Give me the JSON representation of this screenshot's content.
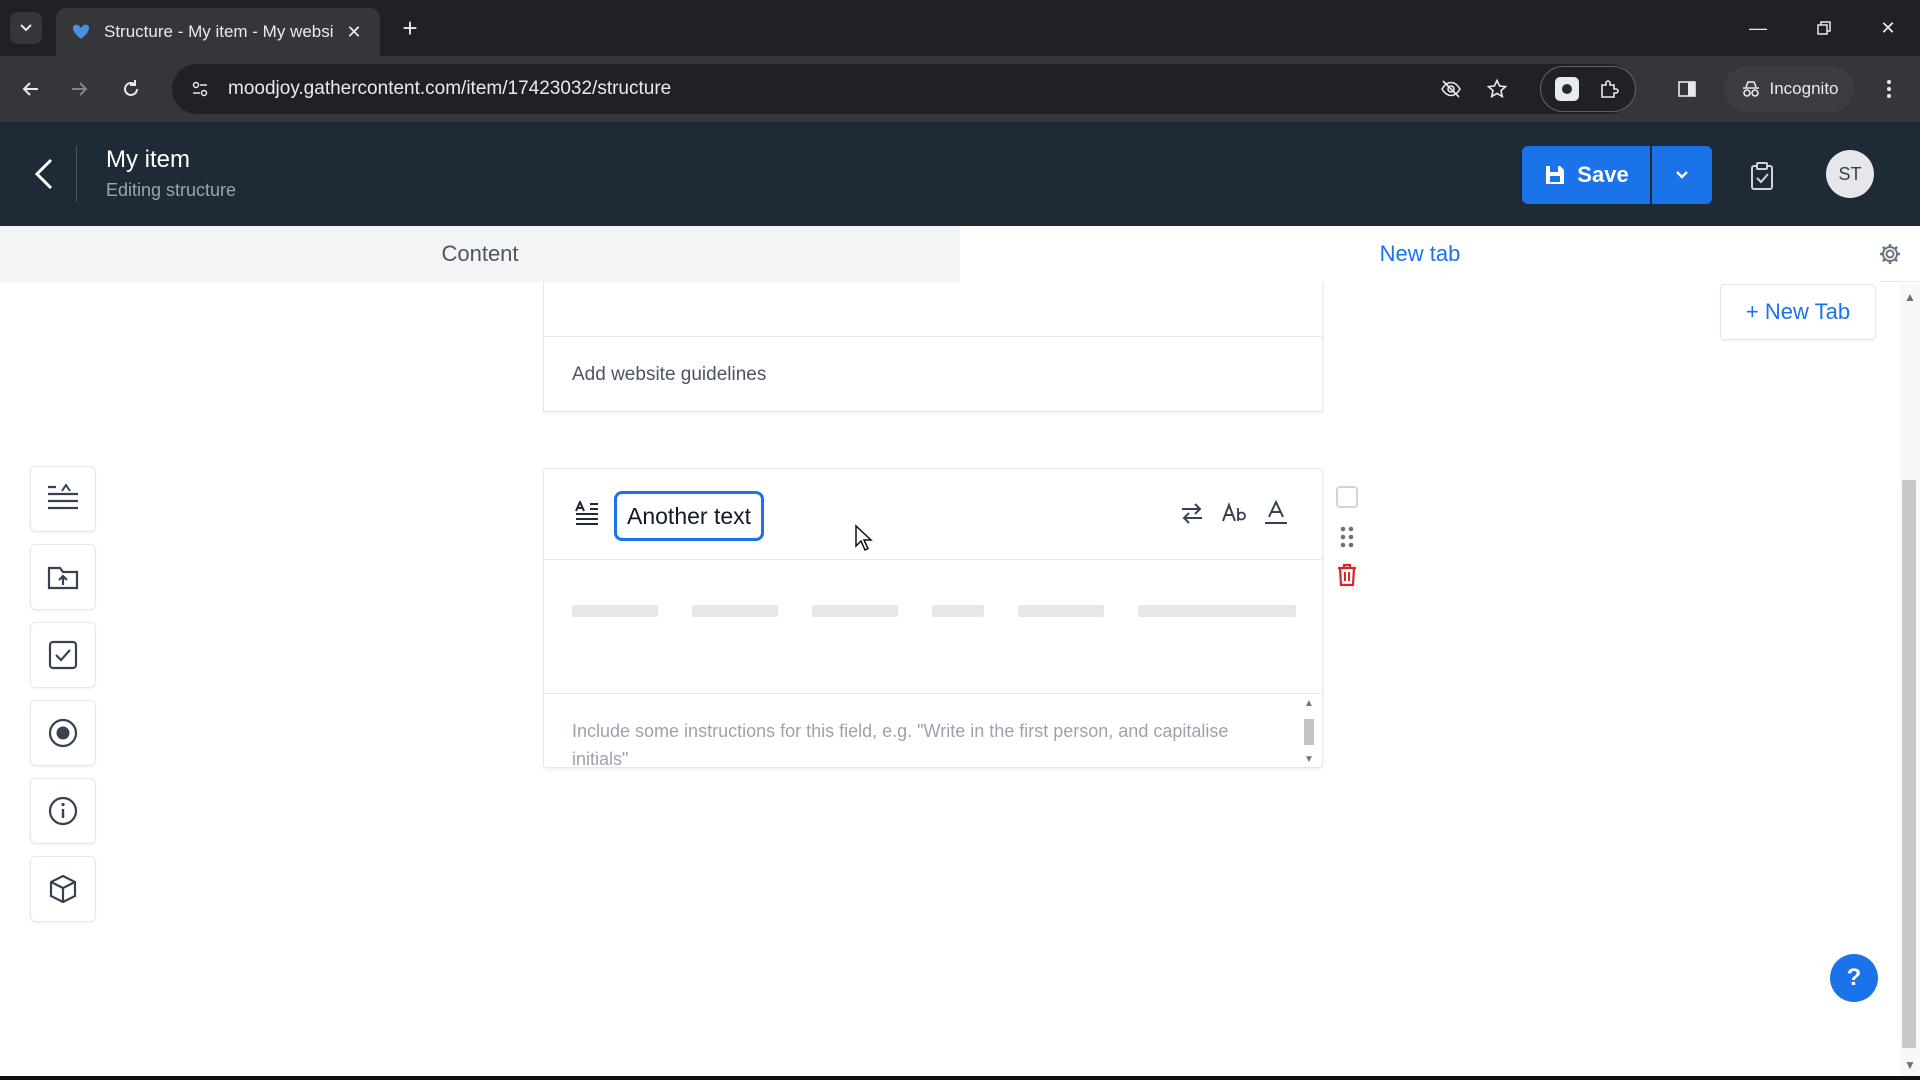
{
  "browser": {
    "tab_title": "Structure - My item - My websi",
    "url": "moodjoy.gathercontent.com/item/17423032/structure",
    "incognito_label": "Incognito"
  },
  "header": {
    "title": "My item",
    "subtitle": "Editing structure",
    "save_label": "Save",
    "avatar_initials": "ST"
  },
  "tabs": [
    {
      "label": "Content",
      "active": false
    },
    {
      "label": "New tab",
      "active": true
    }
  ],
  "main": {
    "new_tab_button": "+ New Tab",
    "previous_field_guidelines": "Add website guidelines",
    "field": {
      "name": "Another text",
      "instructions_placeholder": "Include some instructions for this field, e.g. \"Write in the first person, and capitalise initials\""
    },
    "help_label": "?"
  },
  "colors": {
    "accent": "#1a73e8",
    "header_bg": "#1f2a37",
    "danger": "#dc2626"
  },
  "icons": {
    "left_tools": [
      "text-field-icon",
      "upload-icon",
      "checkbox-icon",
      "radio-icon",
      "info-icon",
      "component-icon"
    ]
  }
}
